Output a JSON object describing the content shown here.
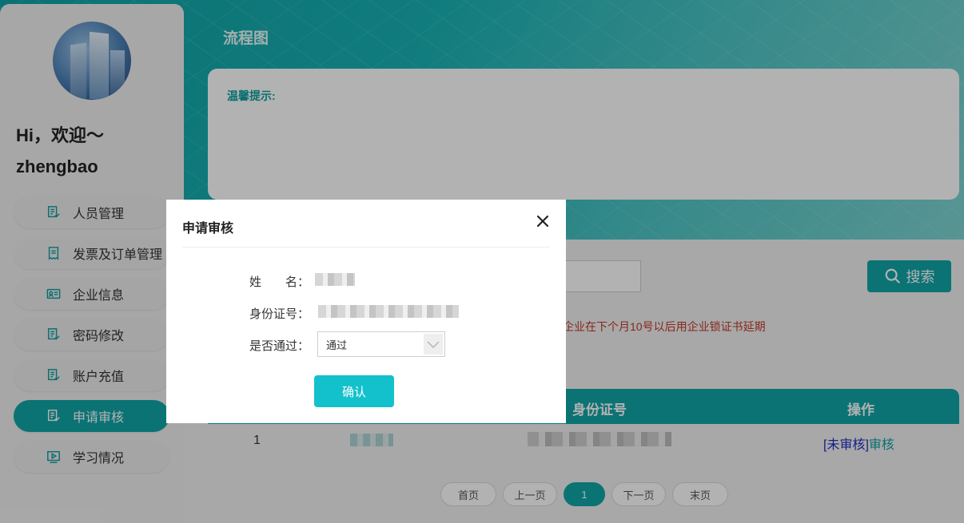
{
  "sidebar": {
    "greeting_line1": "Hi，欢迎～",
    "greeting_line2": "zhengbao",
    "items": [
      {
        "label": "人员管理",
        "icon": "document-list-icon",
        "active": false
      },
      {
        "label": "发票及订单管理",
        "icon": "receipt-icon",
        "active": false
      },
      {
        "label": "企业信息",
        "icon": "id-card-icon",
        "active": false
      },
      {
        "label": "密码修改",
        "icon": "document-list-icon",
        "active": false
      },
      {
        "label": "账户充值",
        "icon": "document-list-icon",
        "active": false
      },
      {
        "label": "申请审核",
        "icon": "document-list-icon",
        "active": true
      },
      {
        "label": "学习情况",
        "icon": "video-play-icon",
        "active": false
      }
    ]
  },
  "main": {
    "page_title": "流程图",
    "tips_label": "温馨提示:",
    "search_button": "搜索",
    "notice": "企业在下个月10号以后用企业锁证书延期",
    "table": {
      "headers": {
        "id_number": "身份证号",
        "operation": "操作"
      },
      "rows": [
        {
          "index": "1",
          "status": "[未审核]",
          "action": "审核"
        }
      ]
    },
    "pager": {
      "first": "首页",
      "prev": "上一页",
      "current": "1",
      "next": "下一页",
      "last": "末页"
    }
  },
  "modal": {
    "title": "申请审核",
    "name_label": "姓　　名：",
    "id_label": "身份证号：",
    "pass_label": "是否通过：",
    "pass_value": "通过",
    "confirm": "确认"
  },
  "colors": {
    "accent": "#10a5a7",
    "confirm": "#13c1cc",
    "notice_red": "#c0392b",
    "status_blue": "#1f2fbf"
  }
}
